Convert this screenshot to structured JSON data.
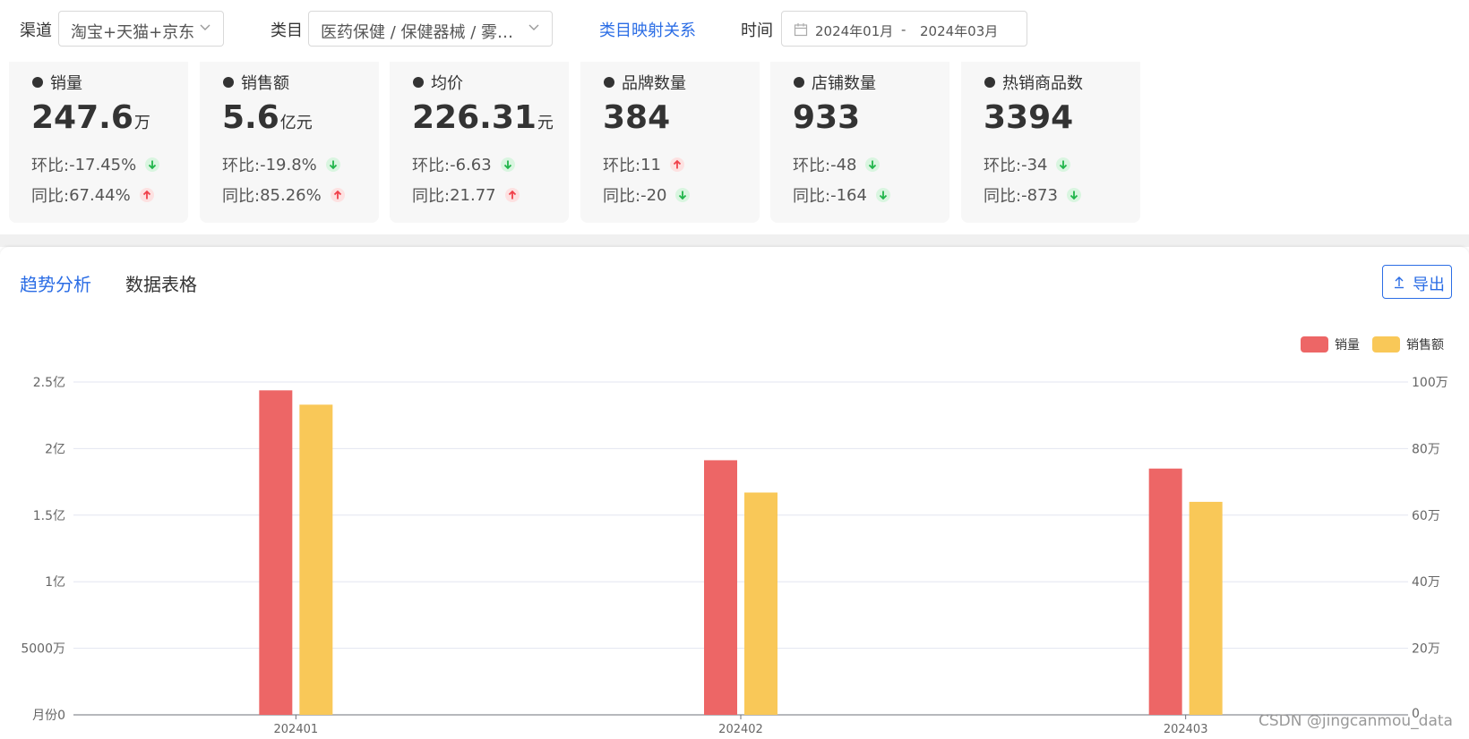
{
  "filters": {
    "channel_label": "渠道",
    "channel_value": "淘宝+天猫+京东",
    "category_label": "类目",
    "category_value": "医药保健 / 保健器械 / 雾…",
    "mapping_link": "类目映射关系",
    "time_label": "时间",
    "date_start": "2024年01月",
    "date_sep": "-",
    "date_end": "2024年03月"
  },
  "metrics": [
    {
      "title": "销量",
      "value": "247.6",
      "unit": "万",
      "mom_label": "环比:",
      "mom": "-17.45%",
      "mom_dir": "down",
      "yoy_label": "同比:",
      "yoy": "67.44%",
      "yoy_dir": "up"
    },
    {
      "title": "销售额",
      "value": "5.6",
      "unit": "亿元",
      "mom_label": "环比:",
      "mom": "-19.8%",
      "mom_dir": "down",
      "yoy_label": "同比:",
      "yoy": "85.26%",
      "yoy_dir": "up"
    },
    {
      "title": "均价",
      "value": "226.31",
      "unit": "元",
      "mom_label": "环比:",
      "mom": "-6.63",
      "mom_dir": "down",
      "yoy_label": "同比:",
      "yoy": "21.77",
      "yoy_dir": "up"
    },
    {
      "title": "品牌数量",
      "value": "384",
      "unit": "",
      "mom_label": "环比:",
      "mom": "11",
      "mom_dir": "up",
      "yoy_label": "同比:",
      "yoy": "-20",
      "yoy_dir": "down"
    },
    {
      "title": "店铺数量",
      "value": "933",
      "unit": "",
      "mom_label": "环比:",
      "mom": "-48",
      "mom_dir": "down",
      "yoy_label": "同比:",
      "yoy": "-164",
      "yoy_dir": "down"
    },
    {
      "title": "热销商品数",
      "value": "3394",
      "unit": "",
      "mom_label": "环比:",
      "mom": "-34",
      "mom_dir": "down",
      "yoy_label": "同比:",
      "yoy": "-873",
      "yoy_dir": "down"
    }
  ],
  "tabs": {
    "trend": "趋势分析",
    "table": "数据表格"
  },
  "export_label": "导出",
  "colors": {
    "accent": "#2b6de5",
    "sales_volume": "#ed6666",
    "sales_amount": "#f9c858",
    "down_arrow": "#1fb54a",
    "up_arrow": "#f0404a"
  },
  "chart_data": {
    "type": "bar",
    "categories": [
      "202401",
      "202402",
      "202403"
    ],
    "series": [
      {
        "name": "销量",
        "axis": "right",
        "values": [
          975000,
          765000,
          740000
        ]
      },
      {
        "name": "销售额",
        "axis": "left",
        "values": [
          233000000,
          167000000,
          160000000
        ]
      }
    ],
    "y_left": {
      "ticks": [
        "月份0",
        "5000万",
        "1亿",
        "1.5亿",
        "2亿",
        "2.5亿"
      ],
      "ylim": [
        0,
        250000000
      ]
    },
    "y_right": {
      "ticks": [
        "0",
        "20万",
        "40万",
        "60万",
        "80万",
        "100万"
      ],
      "ylim": [
        0,
        1000000
      ]
    },
    "legend": [
      "销量",
      "销售额"
    ],
    "legend_position": "top-right",
    "grid": true
  },
  "watermark": "CSDN @jingcanmou_data"
}
